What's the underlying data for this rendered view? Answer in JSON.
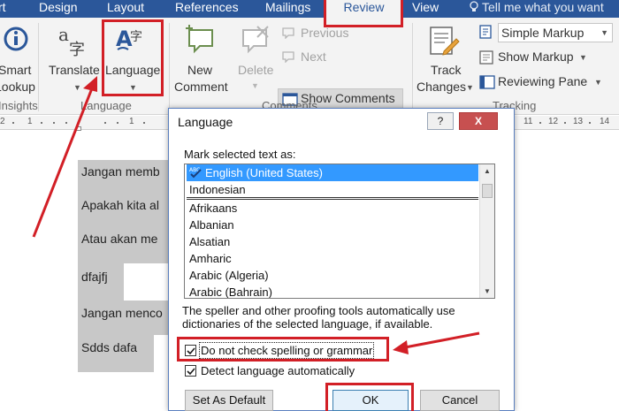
{
  "tabs": [
    {
      "label": "rt"
    },
    {
      "label": "Design"
    },
    {
      "label": "Layout"
    },
    {
      "label": "References"
    },
    {
      "label": "Mailings"
    },
    {
      "label": "Review"
    },
    {
      "label": "View"
    }
  ],
  "tell_me": "Tell me what you want",
  "ribbon": {
    "smart_lookup": [
      "Smart",
      "Lookup"
    ],
    "insights_group": "Insights",
    "translate": "Translate",
    "language": "Language",
    "language_group": "Language",
    "new_comment": [
      "New",
      "Comment"
    ],
    "delete": "Delete",
    "previous": "Previous",
    "next": "Next",
    "show_comments": "Show Comments",
    "comments_group": "Comments",
    "track_changes": [
      "Track",
      "Changes"
    ],
    "simple_markup": "Simple Markup",
    "show_markup": "Show Markup",
    "reviewing_pane": "Reviewing Pane",
    "tracking_group": "Tracking"
  },
  "ruler": {
    "left_numbers": [
      "2",
      "1",
      "1"
    ],
    "right_numbers": [
      "11",
      "12",
      "13",
      "14"
    ]
  },
  "document": {
    "lines": [
      "Jangan memb",
      "Apakah kita al",
      "Atau akan me",
      "dfajfj",
      "Jangan menco",
      "Sdds dafa"
    ]
  },
  "dialog": {
    "title": "Language",
    "help": "?",
    "close": "X",
    "mark_label": "Mark selected text as:",
    "languages_top": [
      "English (United States)",
      "Indonesian"
    ],
    "languages": [
      "Afrikaans",
      "Albanian",
      "Alsatian",
      "Amharic",
      "Arabic (Algeria)",
      "Arabic (Bahrain)"
    ],
    "selected": "English (United States)",
    "description": "The speller and other proofing tools automatically use dictionaries of the selected language, if available.",
    "no_proof": {
      "label": "Do not check spelling or grammar",
      "checked": true
    },
    "detect": {
      "label": "Detect language automatically",
      "checked": true
    },
    "set_default": "Set As Default",
    "ok": "OK",
    "cancel": "Cancel"
  },
  "colors": {
    "ribbon_blue": "#2b579a",
    "annotation_red": "#d21f26",
    "selection_blue": "#3399ff"
  }
}
